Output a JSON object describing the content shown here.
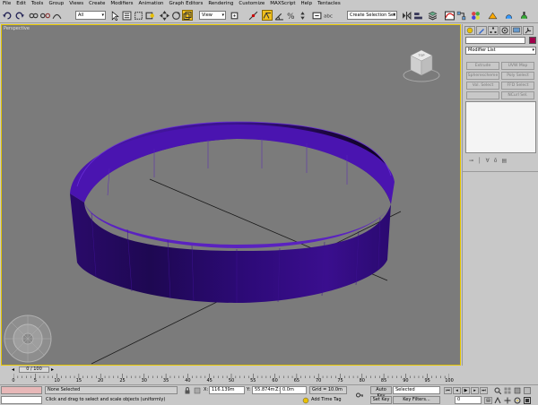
{
  "menu": [
    "File",
    "Edit",
    "Tools",
    "Group",
    "Views",
    "Create",
    "Modifiers",
    "Animation",
    "Graph Editors",
    "Rendering",
    "Customize",
    "MAXScript",
    "Help",
    "Tentacles"
  ],
  "toolbar": {
    "filter_value": "All",
    "refcoord_value": "View",
    "selection_set_placeholder": "Create Selection Set"
  },
  "viewport": {
    "label": "Perspective",
    "viewcube": "TOP"
  },
  "command_panel": {
    "modifier_list": "Modifier List",
    "buttons": [
      "Extrude",
      "UVW Map",
      "Spherescheme",
      "Poly Select",
      "Vol. Select",
      "FFD Select",
      "",
      "NCurl Sel."
    ]
  },
  "timeline": {
    "slider_label": "0 / 100",
    "ticks": [
      "0",
      "5",
      "10",
      "15",
      "20",
      "25",
      "30",
      "35",
      "40",
      "45",
      "50",
      "55",
      "60",
      "65",
      "70",
      "75",
      "80",
      "85",
      "90",
      "95",
      "100"
    ]
  },
  "status": {
    "selection": "None Selected",
    "prompt": "Click and drag to select and scale objects (uniformly)",
    "x_label": "X:",
    "x_value": "116.139m",
    "y_label": "Y:",
    "y_value": "55.874m",
    "z_label": "Z:",
    "z_value": "0.0m",
    "grid": "Grid = 10.0m",
    "add_time_tag": "Add Time Tag",
    "auto_key": "Auto Key",
    "set_key": "Set Key",
    "key_filters": "Key Filters...",
    "selected_dropdown": "Selected",
    "frame_value": "0"
  },
  "colors": {
    "object": "#3a0a8a",
    "viewport_bg": "#7b7b7b",
    "active_border": "#e6c700"
  }
}
